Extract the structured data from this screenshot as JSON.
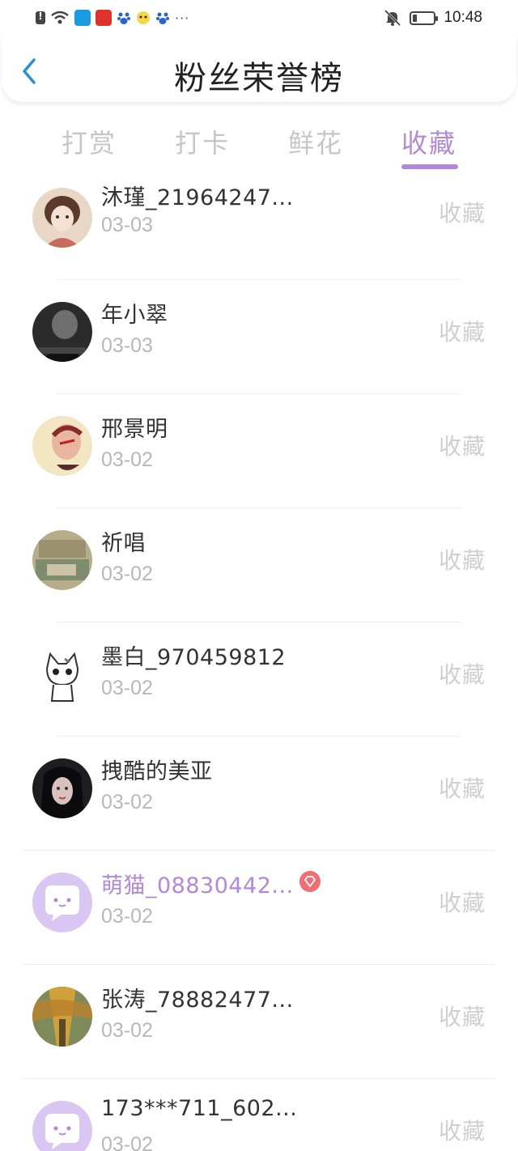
{
  "status_bar": {
    "time": "10:48",
    "icons": [
      "alert-icon",
      "wifi-icon",
      "app-icon",
      "app-icon",
      "paw-icon",
      "app-icon",
      "paw-icon",
      "more-icon",
      "mute-icon",
      "battery-icon"
    ],
    "more": "···"
  },
  "header": {
    "title": "粉丝荣誉榜",
    "back_icon": "chevron-left-icon"
  },
  "tabs": [
    {
      "label": "打赏",
      "active": false
    },
    {
      "label": "打卡",
      "active": false
    },
    {
      "label": "鲜花",
      "active": false
    },
    {
      "label": "收藏",
      "active": true
    }
  ],
  "colors": {
    "accent": "#b388d8",
    "inactive_tab": "#c6c6c6",
    "date": "#b8b8b8",
    "action": "#cfcfcf",
    "badge": "#ef6f75"
  },
  "fans": [
    {
      "name": "沐瑾_21964247...",
      "date": "03-03",
      "action": "收藏",
      "avatar": "illustration-girl-avatar"
    },
    {
      "name": "年小翠",
      "date": "03-03",
      "action": "收藏",
      "avatar": "dark-photo-avatar"
    },
    {
      "name": "邢景明",
      "date": "03-02",
      "action": "收藏",
      "avatar": "opera-mask-avatar"
    },
    {
      "name": "祈唱",
      "date": "03-02",
      "action": "收藏",
      "avatar": "vintage-photo-avatar"
    },
    {
      "name": "墨白_970459812",
      "date": "03-02",
      "action": "收藏",
      "avatar": "cartoon-cat-avatar"
    },
    {
      "name": "拽酷的美亚",
      "date": "03-02",
      "action": "收藏",
      "avatar": "girl-photo-avatar"
    },
    {
      "name": "萌猫_08830442...",
      "date": "03-02",
      "action": "收藏",
      "avatar": "default-chat-avatar",
      "highlight": true,
      "badge": "diamond-badge-icon"
    },
    {
      "name": "张涛_78882477...",
      "date": "03-02",
      "action": "收藏",
      "avatar": "golden-tree-avatar"
    },
    {
      "name": "173***711_602...",
      "date": "03-02",
      "action": "收藏",
      "avatar": "default-chat-avatar"
    }
  ]
}
